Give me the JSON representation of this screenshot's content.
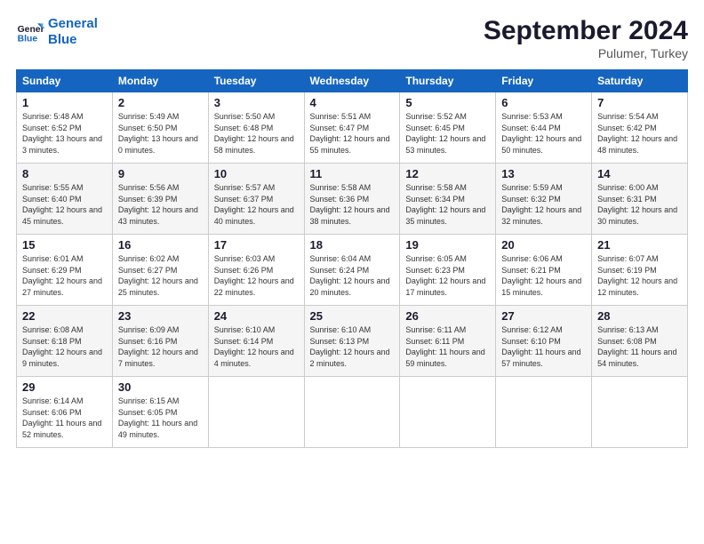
{
  "header": {
    "logo_line1": "General",
    "logo_line2": "Blue",
    "month_title": "September 2024",
    "subtitle": "Pulumer, Turkey"
  },
  "days_of_week": [
    "Sunday",
    "Monday",
    "Tuesday",
    "Wednesday",
    "Thursday",
    "Friday",
    "Saturday"
  ],
  "weeks": [
    [
      {
        "day": "1",
        "sunrise": "Sunrise: 5:48 AM",
        "sunset": "Sunset: 6:52 PM",
        "daylight": "Daylight: 13 hours and 3 minutes."
      },
      {
        "day": "2",
        "sunrise": "Sunrise: 5:49 AM",
        "sunset": "Sunset: 6:50 PM",
        "daylight": "Daylight: 13 hours and 0 minutes."
      },
      {
        "day": "3",
        "sunrise": "Sunrise: 5:50 AM",
        "sunset": "Sunset: 6:48 PM",
        "daylight": "Daylight: 12 hours and 58 minutes."
      },
      {
        "day": "4",
        "sunrise": "Sunrise: 5:51 AM",
        "sunset": "Sunset: 6:47 PM",
        "daylight": "Daylight: 12 hours and 55 minutes."
      },
      {
        "day": "5",
        "sunrise": "Sunrise: 5:52 AM",
        "sunset": "Sunset: 6:45 PM",
        "daylight": "Daylight: 12 hours and 53 minutes."
      },
      {
        "day": "6",
        "sunrise": "Sunrise: 5:53 AM",
        "sunset": "Sunset: 6:44 PM",
        "daylight": "Daylight: 12 hours and 50 minutes."
      },
      {
        "day": "7",
        "sunrise": "Sunrise: 5:54 AM",
        "sunset": "Sunset: 6:42 PM",
        "daylight": "Daylight: 12 hours and 48 minutes."
      }
    ],
    [
      {
        "day": "8",
        "sunrise": "Sunrise: 5:55 AM",
        "sunset": "Sunset: 6:40 PM",
        "daylight": "Daylight: 12 hours and 45 minutes."
      },
      {
        "day": "9",
        "sunrise": "Sunrise: 5:56 AM",
        "sunset": "Sunset: 6:39 PM",
        "daylight": "Daylight: 12 hours and 43 minutes."
      },
      {
        "day": "10",
        "sunrise": "Sunrise: 5:57 AM",
        "sunset": "Sunset: 6:37 PM",
        "daylight": "Daylight: 12 hours and 40 minutes."
      },
      {
        "day": "11",
        "sunrise": "Sunrise: 5:58 AM",
        "sunset": "Sunset: 6:36 PM",
        "daylight": "Daylight: 12 hours and 38 minutes."
      },
      {
        "day": "12",
        "sunrise": "Sunrise: 5:58 AM",
        "sunset": "Sunset: 6:34 PM",
        "daylight": "Daylight: 12 hours and 35 minutes."
      },
      {
        "day": "13",
        "sunrise": "Sunrise: 5:59 AM",
        "sunset": "Sunset: 6:32 PM",
        "daylight": "Daylight: 12 hours and 32 minutes."
      },
      {
        "day": "14",
        "sunrise": "Sunrise: 6:00 AM",
        "sunset": "Sunset: 6:31 PM",
        "daylight": "Daylight: 12 hours and 30 minutes."
      }
    ],
    [
      {
        "day": "15",
        "sunrise": "Sunrise: 6:01 AM",
        "sunset": "Sunset: 6:29 PM",
        "daylight": "Daylight: 12 hours and 27 minutes."
      },
      {
        "day": "16",
        "sunrise": "Sunrise: 6:02 AM",
        "sunset": "Sunset: 6:27 PM",
        "daylight": "Daylight: 12 hours and 25 minutes."
      },
      {
        "day": "17",
        "sunrise": "Sunrise: 6:03 AM",
        "sunset": "Sunset: 6:26 PM",
        "daylight": "Daylight: 12 hours and 22 minutes."
      },
      {
        "day": "18",
        "sunrise": "Sunrise: 6:04 AM",
        "sunset": "Sunset: 6:24 PM",
        "daylight": "Daylight: 12 hours and 20 minutes."
      },
      {
        "day": "19",
        "sunrise": "Sunrise: 6:05 AM",
        "sunset": "Sunset: 6:23 PM",
        "daylight": "Daylight: 12 hours and 17 minutes."
      },
      {
        "day": "20",
        "sunrise": "Sunrise: 6:06 AM",
        "sunset": "Sunset: 6:21 PM",
        "daylight": "Daylight: 12 hours and 15 minutes."
      },
      {
        "day": "21",
        "sunrise": "Sunrise: 6:07 AM",
        "sunset": "Sunset: 6:19 PM",
        "daylight": "Daylight: 12 hours and 12 minutes."
      }
    ],
    [
      {
        "day": "22",
        "sunrise": "Sunrise: 6:08 AM",
        "sunset": "Sunset: 6:18 PM",
        "daylight": "Daylight: 12 hours and 9 minutes."
      },
      {
        "day": "23",
        "sunrise": "Sunrise: 6:09 AM",
        "sunset": "Sunset: 6:16 PM",
        "daylight": "Daylight: 12 hours and 7 minutes."
      },
      {
        "day": "24",
        "sunrise": "Sunrise: 6:10 AM",
        "sunset": "Sunset: 6:14 PM",
        "daylight": "Daylight: 12 hours and 4 minutes."
      },
      {
        "day": "25",
        "sunrise": "Sunrise: 6:10 AM",
        "sunset": "Sunset: 6:13 PM",
        "daylight": "Daylight: 12 hours and 2 minutes."
      },
      {
        "day": "26",
        "sunrise": "Sunrise: 6:11 AM",
        "sunset": "Sunset: 6:11 PM",
        "daylight": "Daylight: 11 hours and 59 minutes."
      },
      {
        "day": "27",
        "sunrise": "Sunrise: 6:12 AM",
        "sunset": "Sunset: 6:10 PM",
        "daylight": "Daylight: 11 hours and 57 minutes."
      },
      {
        "day": "28",
        "sunrise": "Sunrise: 6:13 AM",
        "sunset": "Sunset: 6:08 PM",
        "daylight": "Daylight: 11 hours and 54 minutes."
      }
    ],
    [
      {
        "day": "29",
        "sunrise": "Sunrise: 6:14 AM",
        "sunset": "Sunset: 6:06 PM",
        "daylight": "Daylight: 11 hours and 52 minutes."
      },
      {
        "day": "30",
        "sunrise": "Sunrise: 6:15 AM",
        "sunset": "Sunset: 6:05 PM",
        "daylight": "Daylight: 11 hours and 49 minutes."
      },
      null,
      null,
      null,
      null,
      null
    ]
  ]
}
